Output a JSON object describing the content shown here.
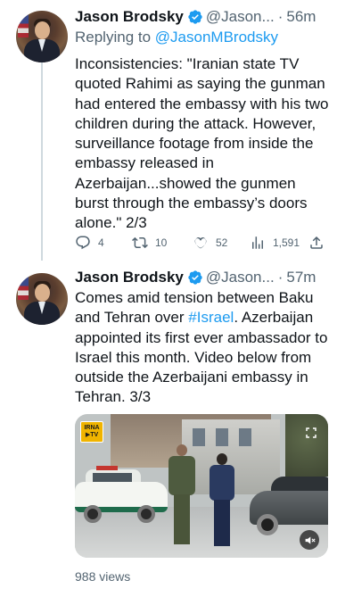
{
  "tweets": [
    {
      "author": {
        "name": "Jason Brodsky",
        "handle": "@Jason...",
        "verified": true
      },
      "time": "56m",
      "replying_to": {
        "prefix": "Replying to",
        "handle": "@JasonMBrodsky"
      },
      "text": "Inconsistencies: \"Iranian state TV quoted Rahimi as saying the gunman had entered the embassy with his two children during the attack. However, surveillance footage from inside the embassy released in Azerbaijan...showed the gunmen burst through the embassy’s doors alone.\" 2/3",
      "stats": {
        "replies": "4",
        "retweets": "10",
        "likes": "52",
        "views": "1,591"
      }
    },
    {
      "author": {
        "name": "Jason Brodsky",
        "handle": "@Jason...",
        "verified": true
      },
      "time": "57m",
      "text_before": "Comes amid tension between Baku and Tehran over ",
      "hashtag": "#Israel",
      "text_after": ". Azerbaijan appointed its first ever ambassador to Israel this month. Video below from outside the Azerbaijani embassy in Tehran. 3/3",
      "media": {
        "kind": "video",
        "watermark": "IRNA"
      },
      "views_label": "988 views"
    }
  ],
  "colors": {
    "text": "#0f1419",
    "secondary": "#536471",
    "accent": "#1d9bf0",
    "thread_line": "#cfd9de"
  },
  "icons": [
    "verified-badge-icon",
    "reply-icon",
    "retweet-icon",
    "like-icon",
    "views-icon",
    "share-icon",
    "mute-icon",
    "expand-icon"
  ]
}
